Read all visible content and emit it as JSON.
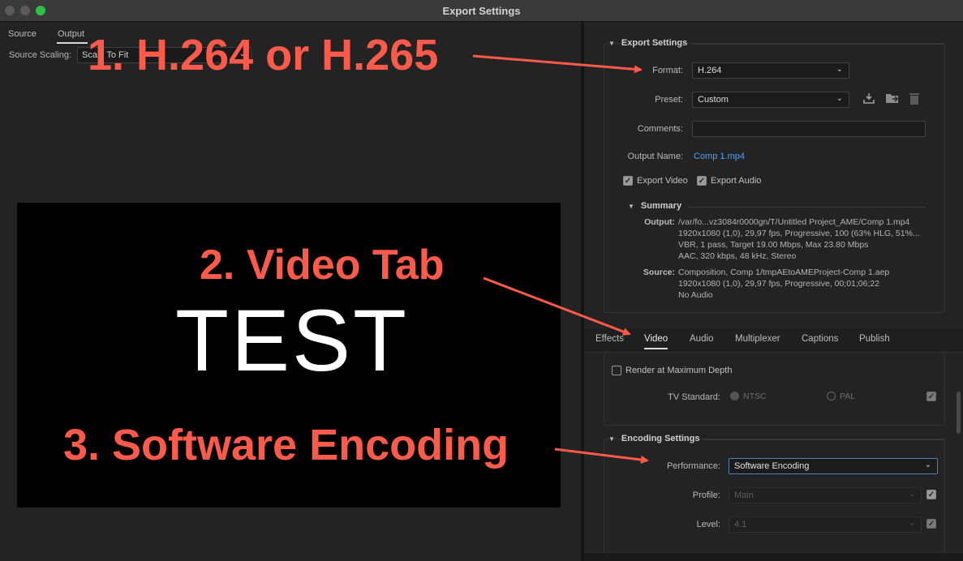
{
  "window": {
    "title": "Export Settings"
  },
  "left": {
    "tabs": [
      "Source",
      "Output"
    ],
    "source_scaling_label": "Source Scaling:",
    "source_scaling_value": "Scale To Fit",
    "preview_text": "TEST"
  },
  "export_settings": {
    "heading": "Export Settings",
    "format_label": "Format:",
    "format_value": "H.264",
    "preset_label": "Preset:",
    "preset_value": "Custom",
    "comments_label": "Comments:",
    "comments_value": "",
    "output_name_label": "Output Name:",
    "output_name_value": "Comp 1.mp4",
    "export_video_label": "Export Video",
    "export_audio_label": "Export Audio",
    "export_video_checked": true,
    "export_audio_checked": true,
    "preset_icons": [
      "save-preset-icon",
      "import-preset-icon",
      "delete-preset-icon"
    ]
  },
  "summary": {
    "heading": "Summary",
    "output_key": "Output:",
    "output_lines": [
      "/var/fo...vz3084r0000gn/T/Untitled Project_AME/Comp 1.mp4",
      "1920x1080 (1,0), 29,97 fps, Progressive, 100 (63% HLG, 51%...",
      "VBR, 1 pass, Target 19.00 Mbps, Max 23.80 Mbps",
      "AAC, 320 kbps, 48 kHz, Stereo"
    ],
    "source_key": "Source:",
    "source_lines": [
      "Composition, Comp 1/tmpAEtoAMEProject-Comp 1.aep",
      "1920x1080 (1,0), 29,97 fps, Progressive, 00;01;06;22",
      "No Audio"
    ]
  },
  "tabs": [
    "Effects",
    "Video",
    "Audio",
    "Multiplexer",
    "Captions",
    "Publish"
  ],
  "active_tab": "Video",
  "video": {
    "render_max_depth_label": "Render at Maximum Depth",
    "tv_standard_label": "TV Standard:",
    "ntsc_label": "NTSC",
    "pal_label": "PAL"
  },
  "encoding": {
    "heading": "Encoding Settings",
    "performance_label": "Performance:",
    "performance_value": "Software Encoding",
    "profile_label": "Profile:",
    "profile_value": "Main",
    "level_label": "Level:",
    "level_value": "4.1"
  },
  "annotations": {
    "a1": "1. H.264 or H.265",
    "a2": "2. Video Tab",
    "a3": "3. Software Encoding",
    "color": "#fc5a4a"
  }
}
